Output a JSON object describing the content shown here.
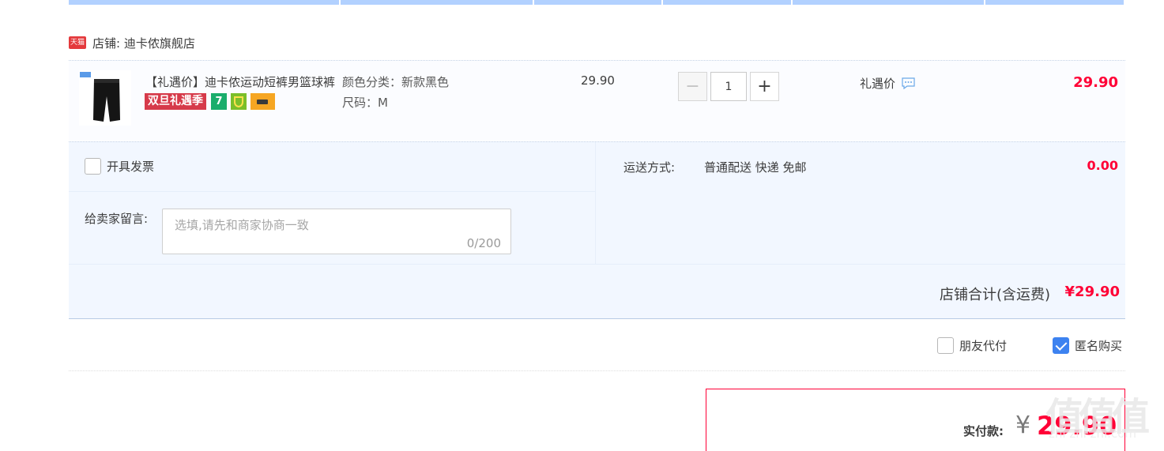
{
  "shop": {
    "logo_text": "天猫",
    "label": "店铺: 迪卡侬旗舰店"
  },
  "item": {
    "title": "【礼遇价】迪卡侬运动短裤男篮球裤",
    "badge_promo": "双旦礼遇季",
    "badge_seven": "7",
    "sku_color": "颜色分类：新款黑色",
    "sku_size": "尺码：M",
    "unit_price": "29.90",
    "qty_minus": "−",
    "qty_value": "1",
    "qty_plus": "+",
    "promo_label": "礼遇价",
    "subtotal": "29.90"
  },
  "options": {
    "invoice_label": "开具发票",
    "message_label": "给卖家留言:",
    "message_placeholder": "选填,请先和商家协商一致",
    "message_count": "0/200",
    "shipping_label": "运送方式:",
    "shipping_value": "普通配送 快递 免邮",
    "shipping_fee": "0.00"
  },
  "shop_total": {
    "label": "店铺合计(含运费)",
    "value": "¥29.90"
  },
  "extras": {
    "friend_pay": "朋友代付",
    "anonymous": "匿名购买",
    "anonymous_checked": true
  },
  "payment": {
    "label": "实付款:",
    "currency": "¥",
    "amount": "29.90"
  },
  "watermark": {
    "glyphs": "值值值",
    "text": "zhi zhi zhi.com"
  },
  "colors": {
    "accent_red": "#ff0036",
    "header_blue": "#b2d1ff",
    "row_bg": "#f2f7ff"
  }
}
